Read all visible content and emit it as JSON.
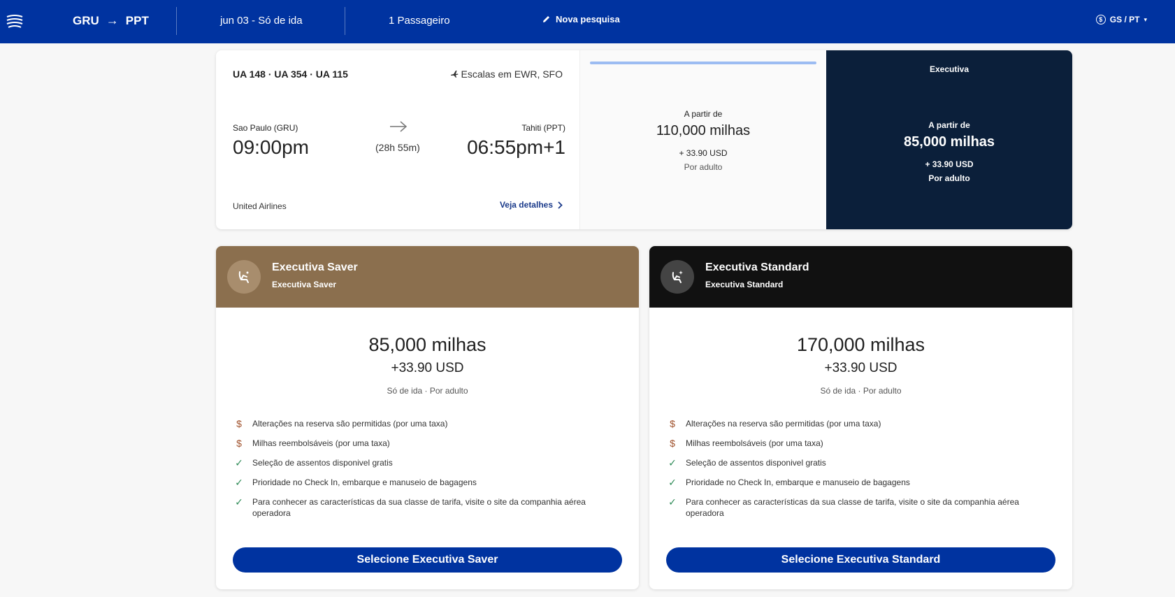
{
  "header": {
    "origin": "GRU",
    "destination": "PPT",
    "route_arrow": "→",
    "date": "jun 03 - Só de ida",
    "passengers": "1 Passageiro",
    "new_search": "Nova pesquisa",
    "locale": "GS / PT",
    "locale_currency_symbol": "$",
    "caret": "▾",
    "brand_color": "#0033a0"
  },
  "flight": {
    "numbers": "UA 148 · UA 354 · UA 115",
    "stops": "Escalas em EWR, SFO",
    "origin_label": "Sao Paulo (GRU)",
    "departure_time": "09:00pm",
    "duration": "(28h 55m)",
    "destination_label": "Tahiti (PPT)",
    "arrival_time": "06:55pm+1",
    "airline": "United Airlines",
    "details_link": "Veja detalhes"
  },
  "price_column_1": {
    "from_label": "A partir de",
    "miles": "110,000 milhas",
    "usd": "+ 33.90 USD",
    "per_adult": "Por adulto"
  },
  "price_column_2": {
    "cabin": "Executiva",
    "from_label": "A partir de",
    "miles": "85,000 milhas",
    "usd": "+ 33.90 USD",
    "per_adult": "Por adulto",
    "bg_color": "#0b1f3a"
  },
  "fares": [
    {
      "title": "Executiva Saver",
      "subtitle": "Executiva Saver",
      "header_color": "#8b6f4e",
      "miles": "85,000 milhas",
      "usd": "+33.90 USD",
      "note": "Só de ida · Por adulto",
      "features": [
        {
          "icon": "dollar-icon",
          "text": "Alterações na reserva são permitidas (por uma taxa)"
        },
        {
          "icon": "dollar-icon",
          "text": "Milhas reembolsáveis (por uma taxa)"
        },
        {
          "icon": "check-icon",
          "text": "Seleção de assentos disponivel gratis"
        },
        {
          "icon": "check-icon",
          "text": "Prioridade no Check In, embarque e manuseio de bagagens"
        },
        {
          "icon": "check-icon",
          "text": "Para conhecer as características da sua classe de tarifa, visite o site da companhia aérea operadora"
        }
      ],
      "button": "Selecione Executiva Saver"
    },
    {
      "title": "Executiva Standard",
      "subtitle": "Executiva Standard",
      "header_color": "#111111",
      "miles": "170,000 milhas",
      "usd": "+33.90 USD",
      "note": "Só de ida · Por adulto",
      "features": [
        {
          "icon": "dollar-icon",
          "text": "Alterações na reserva são permitidas (por uma taxa)"
        },
        {
          "icon": "dollar-icon",
          "text": "Milhas reembolsáveis (por uma taxa)"
        },
        {
          "icon": "check-icon",
          "text": "Seleção de assentos disponivel gratis"
        },
        {
          "icon": "check-icon",
          "text": "Prioridade no Check In, embarque e manuseio de bagagens"
        },
        {
          "icon": "check-icon",
          "text": "Para conhecer as características da sua classe de tarifa, visite o site da companhia aérea operadora"
        }
      ],
      "button": "Selecione Executiva Standard"
    }
  ],
  "feature_glyphs": {
    "dollar": "$",
    "check": "✓"
  }
}
